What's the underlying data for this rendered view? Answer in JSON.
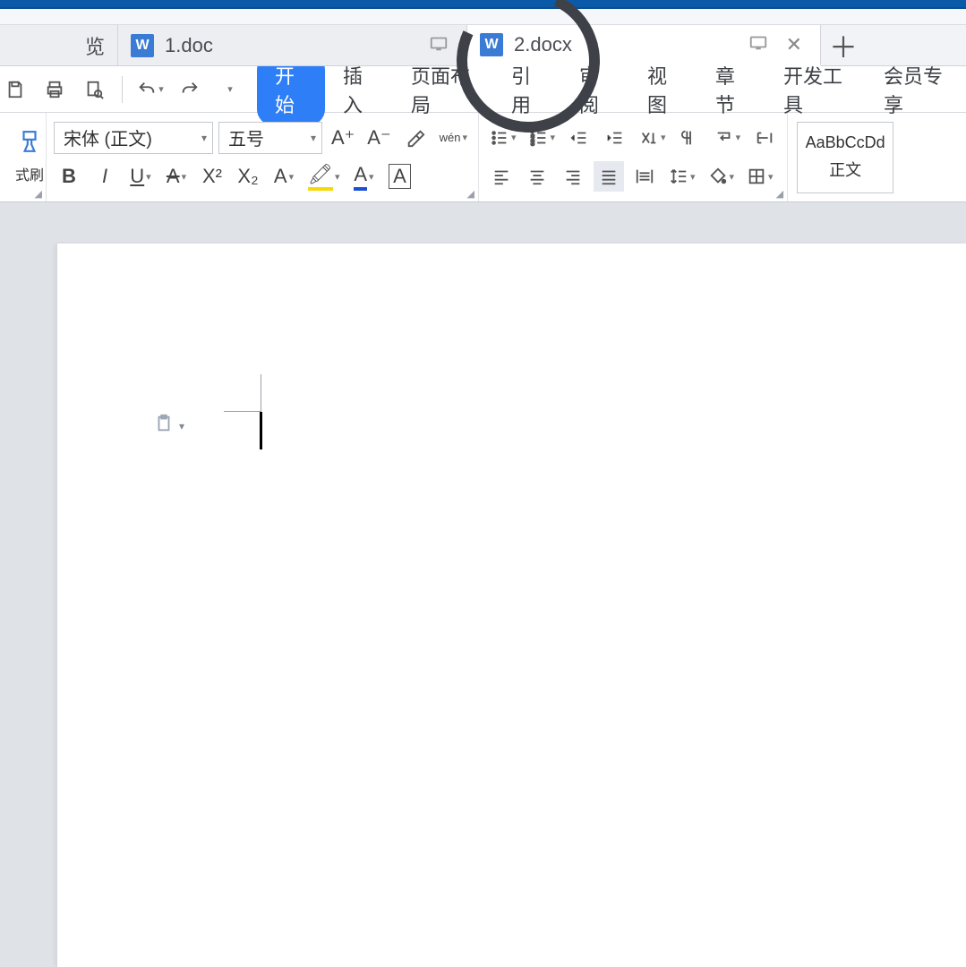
{
  "tabs": {
    "partial_label": "览",
    "t1": {
      "name": "1.doc"
    },
    "t2": {
      "name": "2.docx"
    }
  },
  "menu": {
    "start": "开始",
    "insert": "插入",
    "page_layout": "页面布局",
    "references": "引用",
    "review": "审阅",
    "view": "视图",
    "sections": "章节",
    "dev_tools": "开发工具",
    "member": "会员专享"
  },
  "toolbar": {
    "format_painter": "式刷",
    "font_name": "宋体 (正文)",
    "font_size": "五号",
    "phonetic": "wén",
    "style_sample": "AaBbCcDd",
    "style_name": "正文"
  },
  "glyphs": {
    "bold": "B",
    "italic": "I",
    "underline": "U",
    "sup": "X²",
    "sub": "X₂",
    "textA": "A",
    "increase_font": "A⁺",
    "decrease_font": "A⁻"
  }
}
